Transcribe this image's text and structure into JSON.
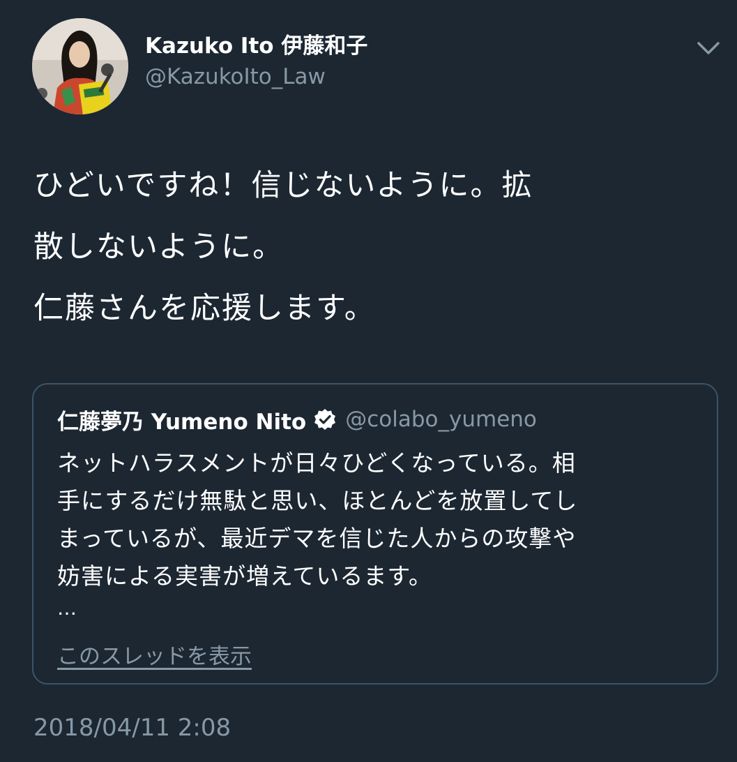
{
  "tweet": {
    "author": {
      "display_name": "Kazuko Ito 伊藤和子",
      "handle": "@KazukoIto_Law"
    },
    "text_lines": [
      "ひどいですね！信じないように。拡",
      "散しないように。",
      "仁藤さんを応援します。"
    ],
    "timestamp": "2018/04/11 2:08",
    "menu_icon": "chevron-down-icon"
  },
  "quoted_tweet": {
    "author_name": "仁藤夢乃  Yumeno Nito",
    "verified_icon": "verified-badge-icon",
    "handle": "@colabo_yumeno",
    "text_lines": [
      "ネットハラスメントが日々ひどくなっている。相",
      "手にするだけ無駄と思い、ほとんどを放置してし",
      "まっているが、最近デマを信じた人からの攻撃や",
      "妨害による実害が増えているます。"
    ],
    "ellipsis": "…",
    "show_thread_label": "このスレッドを表示"
  },
  "colors": {
    "background": "#1c2732",
    "primary_text": "#ffffff",
    "secondary_text": "#8899a6",
    "border": "#3d5466"
  }
}
